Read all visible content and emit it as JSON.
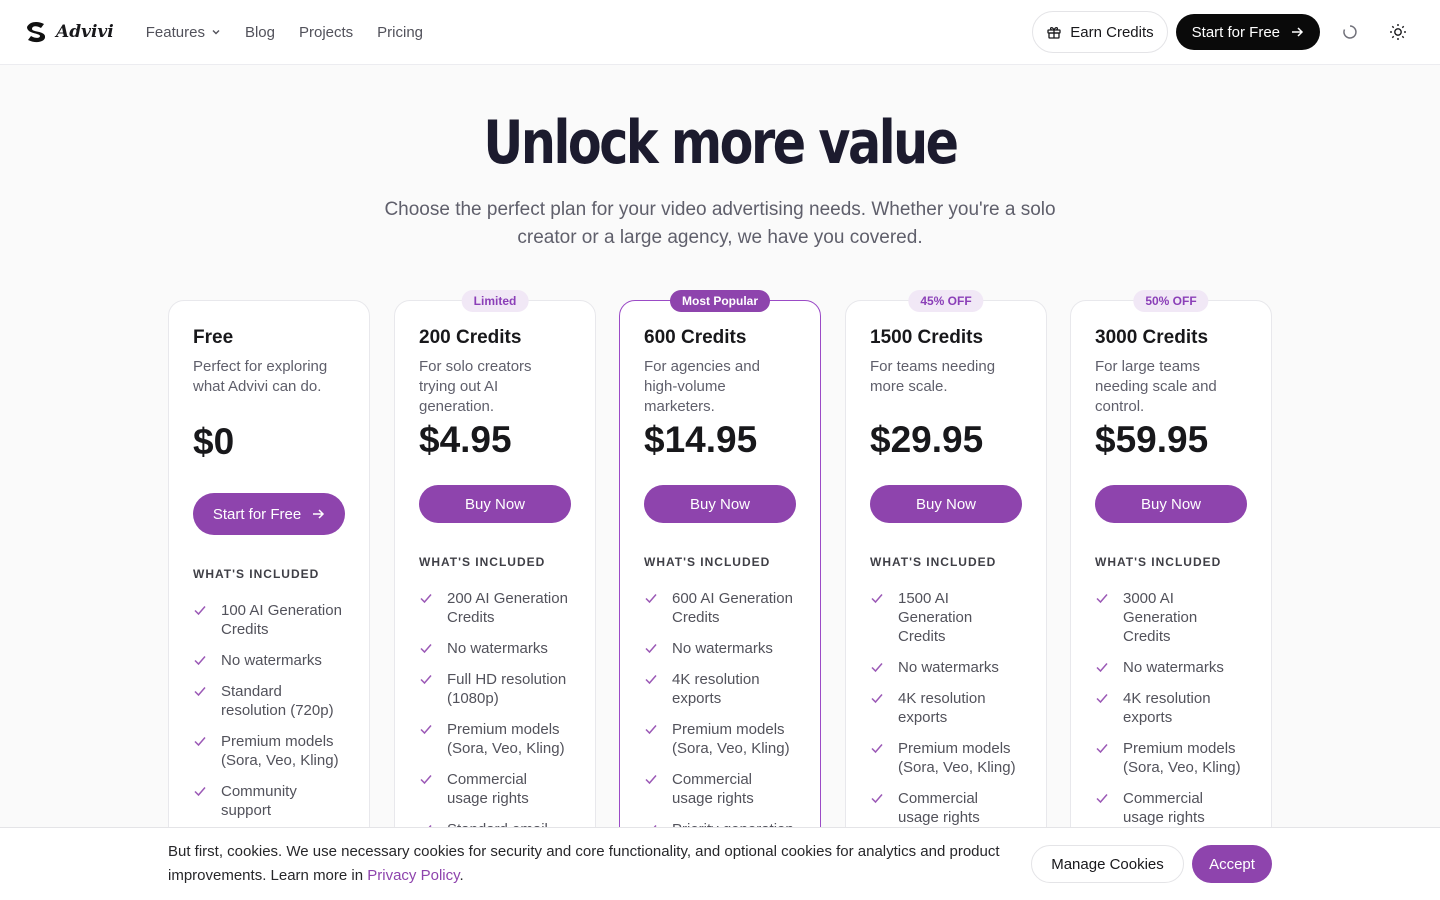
{
  "header": {
    "brand": "Advivi",
    "nav": [
      {
        "label": "Features",
        "has_dropdown": true
      },
      {
        "label": "Blog"
      },
      {
        "label": "Projects"
      },
      {
        "label": "Pricing"
      }
    ],
    "earn_credits_label": "Earn Credits",
    "start_free_label": "Start for Free"
  },
  "hero": {
    "title": "Unlock more value",
    "subtitle": "Choose the perfect plan for your video advertising needs. Whether you're a solo creator or a large agency, we have you covered."
  },
  "included_label": "WHAT'S INCLUDED",
  "plans": [
    {
      "name": "Free",
      "badge": "",
      "description": "Perfect for exploring what Advivi can do.",
      "price": "$0",
      "cta": "Start for Free",
      "features": [
        "100 AI Generation Credits",
        "No watermarks",
        "Standard resolution (720p)",
        "Premium models (Sora, Veo, Kling)",
        "Community support"
      ]
    },
    {
      "name": "200 Credits",
      "badge": "Limited",
      "description": "For solo creators trying out AI generation.",
      "price": "$4.95",
      "cta": "Buy Now",
      "features": [
        "200 AI Generation Credits",
        "No watermarks",
        "Full HD resolution (1080p)",
        "Premium models (Sora, Veo, Kling)",
        "Commercial usage rights",
        "Standard email"
      ]
    },
    {
      "name": "600 Credits",
      "badge": "Most Popular",
      "description": "For agencies and high-volume marketers.",
      "price": "$14.95",
      "cta": "Buy Now",
      "features": [
        "600 AI Generation Credits",
        "No watermarks",
        "4K resolution exports",
        "Premium models (Sora, Veo, Kling)",
        "Commercial usage rights",
        "Priority generation"
      ]
    },
    {
      "name": "1500 Credits",
      "badge": "45% OFF",
      "description": "For teams needing more scale.",
      "price": "$29.95",
      "cta": "Buy Now",
      "features": [
        "1500 AI Generation Credits",
        "No watermarks",
        "4K resolution exports",
        "Premium models (Sora, Veo, Kling)",
        "Commercial usage rights"
      ]
    },
    {
      "name": "3000 Credits",
      "badge": "50% OFF",
      "description": "For large teams needing scale and control.",
      "price": "$59.95",
      "cta": "Buy Now",
      "features": [
        "3000 AI Generation Credits",
        "No watermarks",
        "4K resolution exports",
        "Premium models (Sora, Veo, Kling)",
        "Commercial usage rights"
      ]
    }
  ],
  "cookie": {
    "text": "But first, cookies. We use necessary cookies for security and core functionality, and optional cookies for analytics and product improvements. Learn more in ",
    "link": "Privacy Policy",
    "after_link": ".",
    "manage_label": "Manage Cookies",
    "accept_label": "Accept"
  },
  "colors": {
    "accent": "#8e44ad",
    "badge_bg": "#f1e8f6",
    "dark": "#0a0a0a"
  }
}
